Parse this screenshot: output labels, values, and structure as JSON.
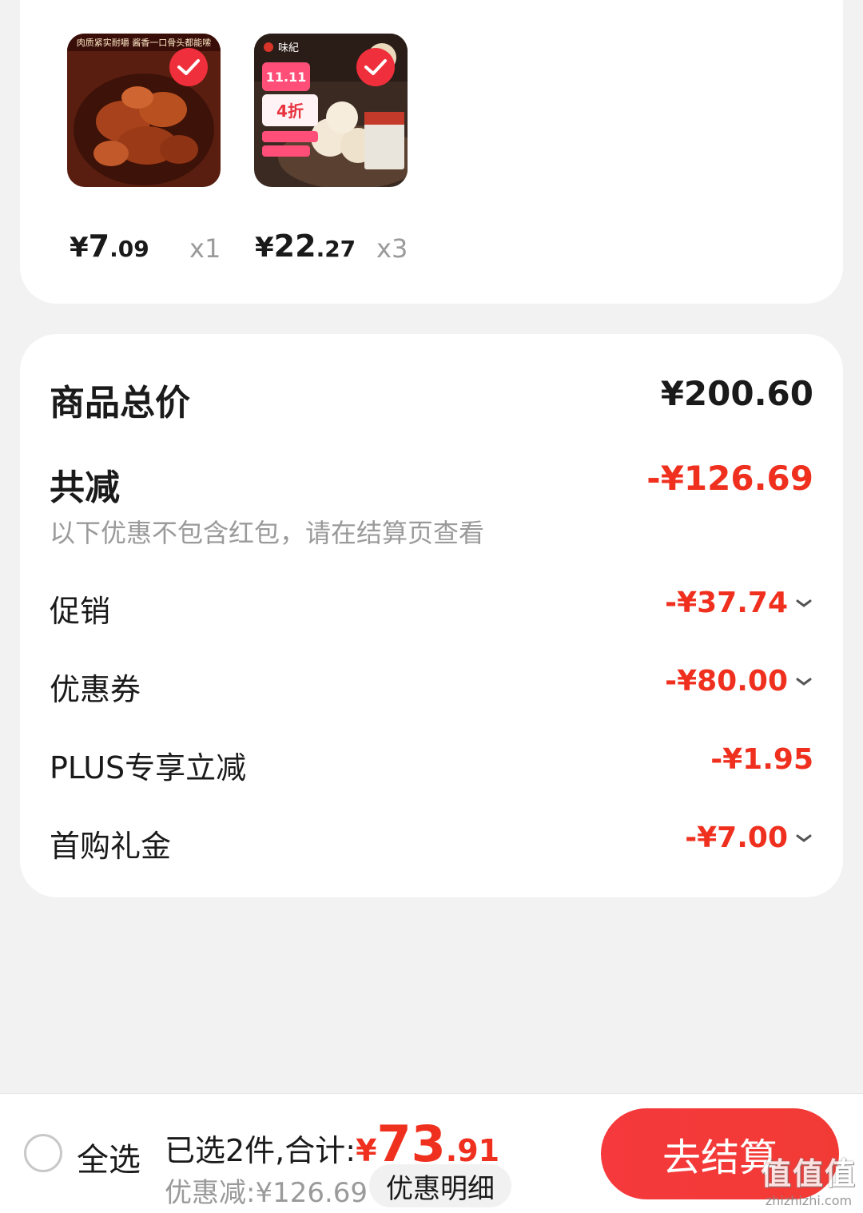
{
  "products": [
    {
      "price_currency": "¥",
      "price_int": "7",
      "price_dec": ".09",
      "qty": "x1",
      "image_text": "肉质紧实耐嚼 酱香一口骨头都能嗦",
      "selected": true
    },
    {
      "price_currency": "¥",
      "price_int": "22",
      "price_dec": ".27",
      "qty": "x3",
      "image_text": "味紀",
      "promo_tag": "11.11",
      "promo_discount": "4折",
      "selected": true
    }
  ],
  "summary": {
    "total_label": "商品总价",
    "total_value": "¥200.60",
    "reduction_label": "共减",
    "reduction_value": "-¥126.69",
    "reduction_note": "以下优惠不包含红包，请在结算页查看",
    "items": [
      {
        "label": "促销",
        "value": "-¥37.74",
        "expandable": true
      },
      {
        "label": "优惠券",
        "value": "-¥80.00",
        "expandable": true
      },
      {
        "label": "PLUS专享立减",
        "value": "-¥1.95",
        "expandable": false
      },
      {
        "label": "首购礼金",
        "value": "-¥7.00",
        "expandable": true
      }
    ]
  },
  "bottom_bar": {
    "select_all_label": "全选",
    "selected_text": "已选2件,合计:",
    "total_currency": "¥",
    "total_int": "73",
    "total_dec": ".91",
    "saving_text": "优惠减:¥126.69",
    "detail_button": "优惠明细",
    "checkout_button": "去结算"
  },
  "watermark": {
    "logo": "值值值",
    "url": "zhizhizhi.com"
  },
  "colors": {
    "accent_red": "#f0301f",
    "button_red": "#f5393c",
    "background": "#f2f2f2",
    "card": "#ffffff"
  }
}
